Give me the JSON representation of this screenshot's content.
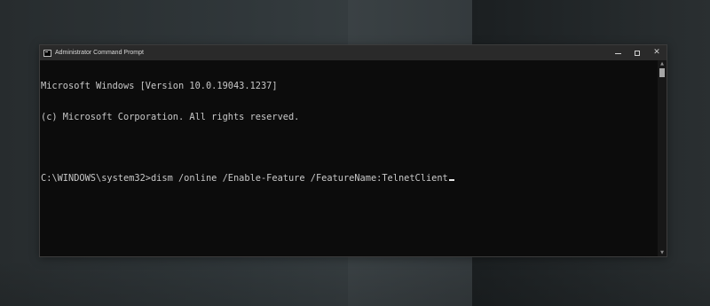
{
  "window": {
    "title": "Administrator Command Prompt",
    "controls": {
      "minimize": "minimize",
      "maximize": "maximize",
      "close": "✕"
    }
  },
  "console": {
    "lines": [
      "Microsoft Windows [Version 10.0.19043.1237]",
      "(c) Microsoft Corporation. All rights reserved.",
      "",
      "C:\\WINDOWS\\system32>dism /online /Enable-Feature /FeatureName:TelnetClient"
    ]
  },
  "scrollbar": {
    "up": "▲",
    "down": "▼"
  },
  "icons": {
    "app": "cmd-icon",
    "minimize": "minimize-icon",
    "maximize": "maximize-icon",
    "close": "close-icon"
  },
  "colors": {
    "console_background": "#0c0c0c",
    "console_text": "#c8c8c8",
    "titlebar": "#2a2a2a"
  }
}
